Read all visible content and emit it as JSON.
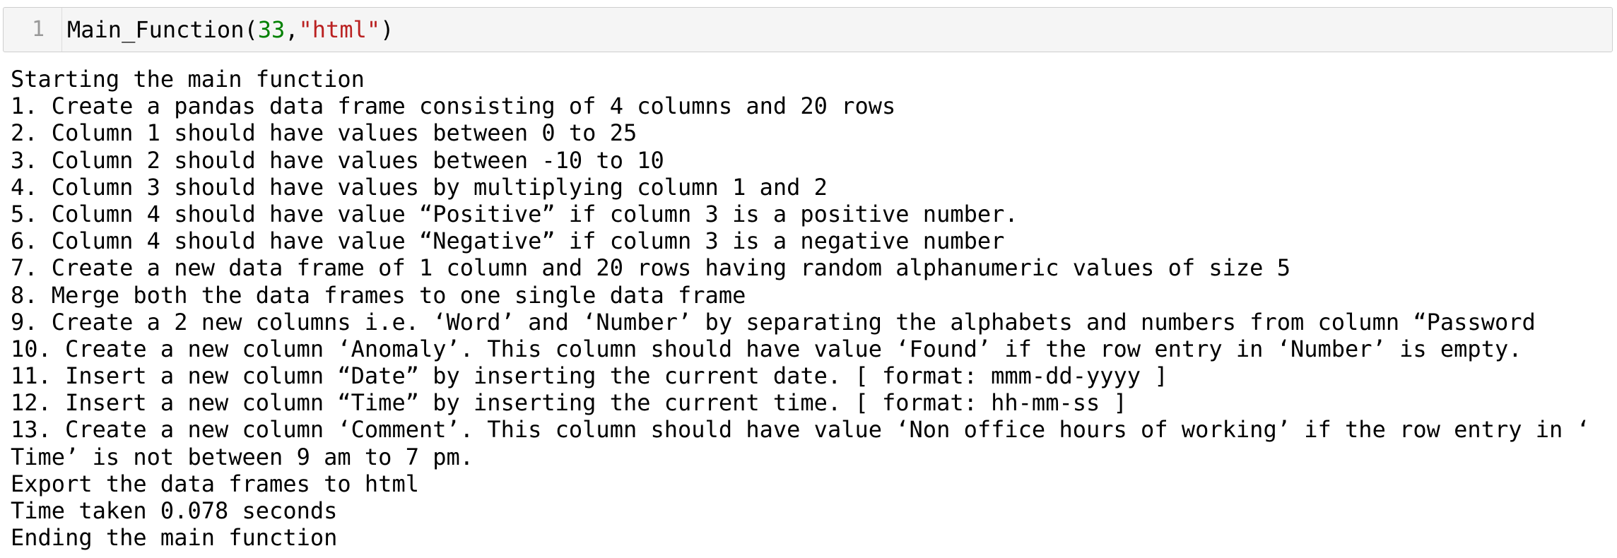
{
  "input_cell": {
    "line_number": "1",
    "code": {
      "function": "Main_Function",
      "open_paren": "(",
      "number_arg": "33",
      "comma": ",",
      "string_arg": "\"html\"",
      "close_paren": ")"
    }
  },
  "output_lines": [
    "Starting the main function",
    "1. Create a pandas data frame consisting of 4 columns and 20 rows",
    "2. Column 1 should have values between 0 to 25",
    "3. Column 2 should have values between -10 to 10",
    "4. Column 3 should have values by multiplying column 1 and 2",
    "5. Column 4 should have value “Positive” if column 3 is a positive number.",
    "6. Column 4 should have value “Negative” if column 3 is a negative number",
    "7. Create a new data frame of 1 column and 20 rows having random alphanumeric values of size 5",
    "8. Merge both the data frames to one single data frame",
    "9. Create a 2 new columns i.e. ‘Word’ and ‘Number’ by separating the alphabets and numbers from column “Password",
    "10. Create a new column ‘Anomaly’. This column should have value ‘Found’ if the row entry in ‘Number’ is empty.",
    "11. Insert a new column “Date” by inserting the current date. [ format: mmm-dd-yyyy ]",
    "12. Insert a new column “Time” by inserting the current time. [ format: hh-mm-ss ]",
    "13. Create a new column ‘Comment’. This column should have value ‘Non office hours of working’ if the row entry in ‘",
    "Time’ is not between 9 am to 7 pm.",
    "Export the data frames to html",
    "Time taken 0.078 seconds",
    "Ending the main function"
  ],
  "colors": {
    "input_background": "#f5f5f5",
    "input_border": "#cfcfcf",
    "line_number": "#999999",
    "number_literal": "#008000",
    "string_literal": "#ba2121",
    "text": "#000000"
  }
}
